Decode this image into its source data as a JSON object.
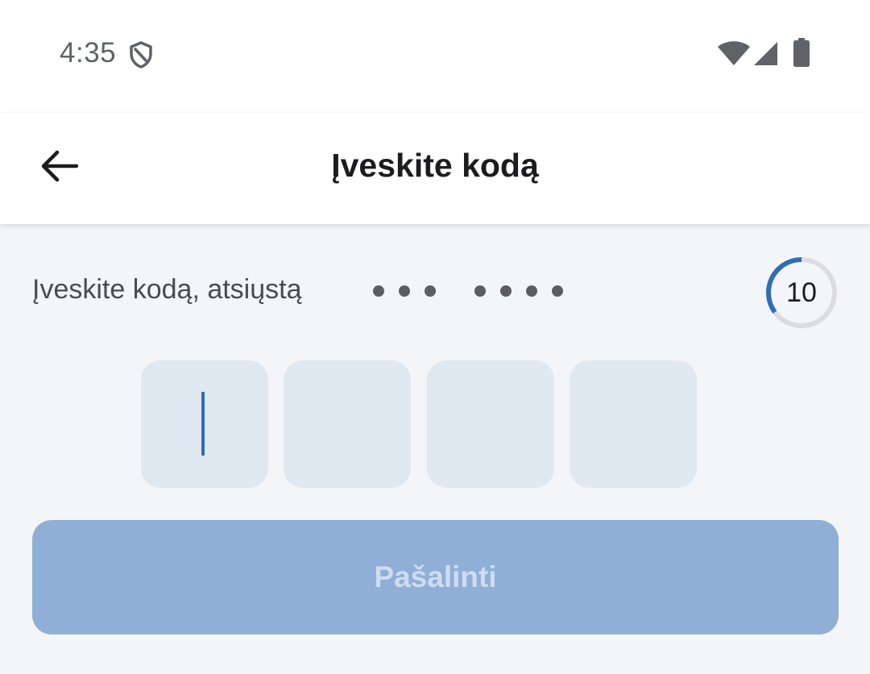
{
  "status_bar": {
    "time": "4:35",
    "icons": [
      "shield-icon",
      "wifi-icon",
      "cellular-signal-icon",
      "battery-icon"
    ]
  },
  "app_bar": {
    "back_icon": "arrow-left-icon",
    "title": "Įveskite kodą"
  },
  "main": {
    "subtitle": "Įveskite kodą, atsiųstą",
    "masked_phone_groups": [
      3,
      4
    ],
    "countdown": {
      "value": "10",
      "progress_fraction": 0.35,
      "progress_color": "#2f6db5",
      "track_color": "#dcdcdf"
    },
    "code_inputs": [
      {
        "value": "",
        "focused": true
      },
      {
        "value": "",
        "focused": false
      },
      {
        "value": "",
        "focused": false
      },
      {
        "value": "",
        "focused": false
      }
    ],
    "remove_button": {
      "label": "Pašalinti",
      "disabled": true,
      "color": "#8fafd7"
    }
  },
  "colors": {
    "accent": "#2f6db5",
    "code_box_bg": "#e0e8f1",
    "background": "#f4f5f8"
  }
}
